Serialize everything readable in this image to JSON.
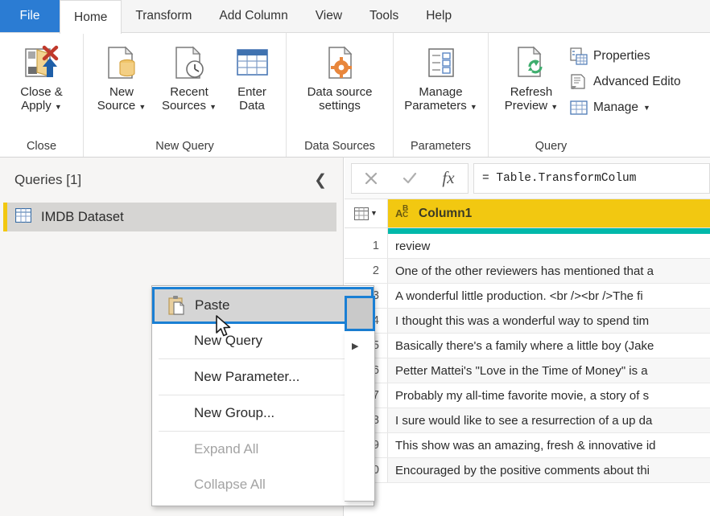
{
  "ribbon": {
    "tabs": [
      {
        "label": "File",
        "kind": "file"
      },
      {
        "label": "Home",
        "kind": "active"
      },
      {
        "label": "Transform",
        "kind": "normal"
      },
      {
        "label": "Add Column",
        "kind": "normal"
      },
      {
        "label": "View",
        "kind": "normal"
      },
      {
        "label": "Tools",
        "kind": "normal"
      },
      {
        "label": "Help",
        "kind": "normal"
      }
    ],
    "groups": [
      {
        "label": "Close",
        "buttons": [
          {
            "label_line1": "Close &",
            "label_line2": "Apply",
            "icon": "close-and-apply-icon",
            "caret": true
          }
        ]
      },
      {
        "label": "New Query",
        "buttons": [
          {
            "label_line1": "New",
            "label_line2": "Source",
            "icon": "new-source-icon",
            "caret": true
          },
          {
            "label_line1": "Recent",
            "label_line2": "Sources",
            "icon": "recent-sources-icon",
            "caret": true
          },
          {
            "label_line1": "Enter",
            "label_line2": "Data",
            "icon": "enter-data-icon",
            "caret": false
          }
        ]
      },
      {
        "label": "Data Sources",
        "buttons": [
          {
            "label_line1": "Data source",
            "label_line2": "settings",
            "icon": "data-source-settings-icon",
            "caret": false
          }
        ]
      },
      {
        "label": "Parameters",
        "buttons": [
          {
            "label_line1": "Manage",
            "label_line2": "Parameters",
            "icon": "manage-parameters-icon",
            "caret": true
          }
        ]
      },
      {
        "label": "Query",
        "buttons": [
          {
            "label_line1": "Refresh",
            "label_line2": "Preview",
            "icon": "refresh-preview-icon",
            "caret": true
          }
        ],
        "small_buttons": [
          {
            "label": "Properties",
            "icon": "properties-icon",
            "caret": false
          },
          {
            "label": "Advanced Edito",
            "icon": "advanced-editor-icon",
            "caret": false
          },
          {
            "label": "Manage",
            "icon": "manage-icon",
            "caret": true
          }
        ]
      }
    ]
  },
  "queries_pane": {
    "title": "Queries [1]",
    "collapse_icon": "chevron-left-icon",
    "items": [
      {
        "label": "IMDB Dataset",
        "icon": "table-icon"
      }
    ]
  },
  "formula_bar": {
    "cancel_icon": "close-icon",
    "accept_icon": "check-icon",
    "fx_icon": "fx-icon",
    "formula": "= Table.TransformColum"
  },
  "grid": {
    "type_icon": "abc-text-type-icon",
    "column_header": "Column1",
    "quality_color": "#01b8aa",
    "header_color": "#f2c811",
    "rows": [
      {
        "num": "1",
        "value": "review"
      },
      {
        "num": "2",
        "value": "One of the other reviewers has mentioned that a"
      },
      {
        "num": "3",
        "value": "A wonderful little production. <br /><br />The fi"
      },
      {
        "num": "4",
        "value": "I thought this was a wonderful way to spend tim"
      },
      {
        "num": "5",
        "value": "Basically there's a family where a little boy (Jake"
      },
      {
        "num": "6",
        "value": "Petter Mattei's \"Love in the Time of Money\" is a"
      },
      {
        "num": "7",
        "value": "Probably my all-time favorite movie, a story of s"
      },
      {
        "num": "8",
        "value": "I sure would like to see a resurrection of a up da"
      },
      {
        "num": "9",
        "value": "This show was an amazing, fresh & innovative id"
      },
      {
        "num": "10",
        "value": "Encouraged by the positive comments about thi"
      }
    ]
  },
  "context_menu": {
    "items": [
      {
        "label": "Paste",
        "icon": "paste-icon",
        "state": "selected",
        "submenu": false
      },
      {
        "label": "New Query",
        "icon": "",
        "state": "normal",
        "submenu": true
      },
      {
        "label": "New Parameter...",
        "icon": "",
        "state": "normal",
        "submenu": false
      },
      {
        "label": "New Group...",
        "icon": "",
        "state": "normal",
        "submenu": false
      },
      {
        "label": "Expand All",
        "icon": "",
        "state": "disabled",
        "submenu": false
      },
      {
        "label": "Collapse All",
        "icon": "",
        "state": "disabled",
        "submenu": false
      }
    ]
  },
  "colors": {
    "file_tab": "#2b7cd3",
    "selection_border": "#1a7fd4",
    "accent_yellow": "#f2c811",
    "teal": "#01b8aa"
  }
}
